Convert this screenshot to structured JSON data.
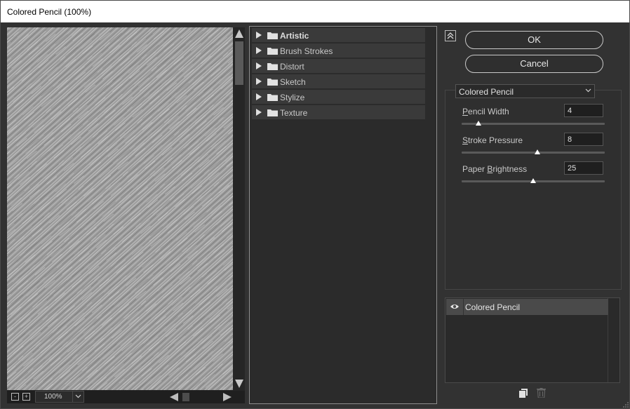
{
  "window": {
    "title": "Colored Pencil (100%)"
  },
  "preview": {
    "zoom": "100%",
    "zoom_out_label": "-",
    "zoom_in_label": "+"
  },
  "categories": [
    {
      "label": "Artistic",
      "selected": true
    },
    {
      "label": "Brush Strokes"
    },
    {
      "label": "Distort"
    },
    {
      "label": "Sketch"
    },
    {
      "label": "Stylize"
    },
    {
      "label": "Texture"
    }
  ],
  "buttons": {
    "ok": "OK",
    "cancel": "Cancel"
  },
  "filter_select": {
    "value": "Colored Pencil"
  },
  "params": [
    {
      "label": "Pencil Width",
      "mnemonic": "P",
      "rest": "encil Width",
      "value": "4",
      "slider_fraction": 0.12
    },
    {
      "label": "Stroke Pressure",
      "mnemonic": "S",
      "rest": "troke Pressure",
      "value": "8",
      "slider_fraction": 0.53
    },
    {
      "label": "Paper Brightness",
      "pre": "Paper ",
      "mnemonic": "B",
      "rest": "rightness",
      "value": "25",
      "slider_fraction": 0.5
    }
  ],
  "layers": [
    {
      "label": "Colored Pencil",
      "visible": true
    }
  ],
  "icons": {
    "collapse": "double-chevron-up-icon",
    "eye": "eye-icon",
    "folder": "folder-icon",
    "new_layer": "new-effect-layer-icon",
    "trash": "trash-icon",
    "chevron": "chevron-down-icon"
  },
  "colors": {
    "background": "#323232",
    "panel": "#2b2b2b",
    "category": "#3a3a3a",
    "selected_layer": "#4a4a4a"
  }
}
